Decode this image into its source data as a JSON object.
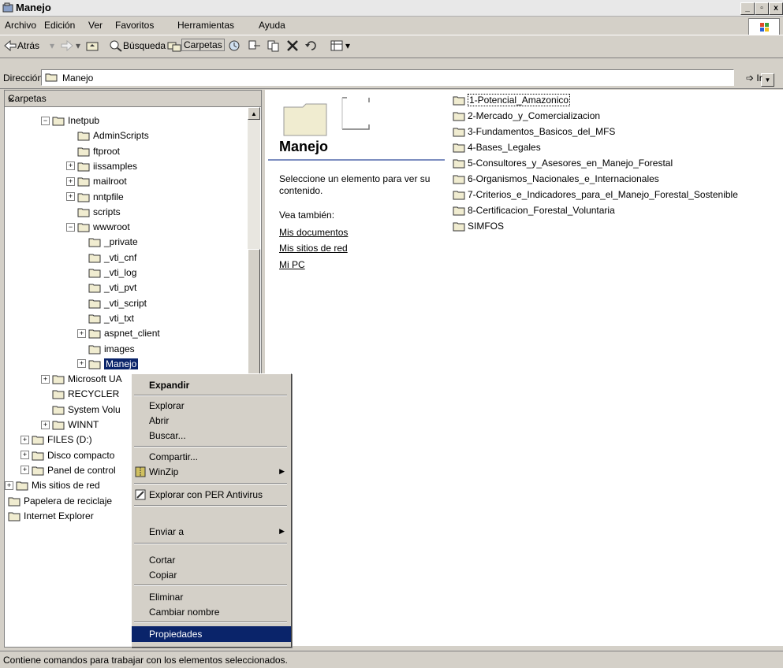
{
  "window": {
    "title": "Manejo",
    "title_icon": "window-icon",
    "minimize": "_",
    "maximize": "▫",
    "close": "x"
  },
  "menu": [
    "Archivo",
    "Edición",
    "Ver",
    "Favoritos",
    "Herramientas",
    "Ayuda"
  ],
  "toolbar": {
    "back": "Atrás",
    "search": "Búsqueda",
    "folders": "Carpetas"
  },
  "address": {
    "label": "Dirección",
    "value": "Manejo",
    "go": "Ir"
  },
  "folders_pane": {
    "title": "Carpetas",
    "close": "×",
    "tree": [
      {
        "label": "Inetpub",
        "expander": "−"
      },
      {
        "label": "AdminScripts",
        "expander": ""
      },
      {
        "label": "ftproot",
        "expander": ""
      },
      {
        "label": "iissamples",
        "expander": "+"
      },
      {
        "label": "mailroot",
        "expander": "+"
      },
      {
        "label": "nntpfile",
        "expander": "+"
      },
      {
        "label": "scripts",
        "expander": ""
      },
      {
        "label": "wwwroot",
        "expander": "−"
      },
      {
        "label": "_private",
        "expander": ""
      },
      {
        "label": "_vti_cnf",
        "expander": ""
      },
      {
        "label": "_vti_log",
        "expander": ""
      },
      {
        "label": "_vti_pvt",
        "expander": ""
      },
      {
        "label": "_vti_script",
        "expander": ""
      },
      {
        "label": "_vti_txt",
        "expander": ""
      },
      {
        "label": "aspnet_client",
        "expander": "+"
      },
      {
        "label": "images",
        "expander": ""
      },
      {
        "label": "Manejo",
        "expander": "+",
        "selected": true
      },
      {
        "label": "Microsoft UA",
        "expander": "+"
      },
      {
        "label": "RECYCLER",
        "expander": ""
      },
      {
        "label": "System Volu",
        "expander": ""
      },
      {
        "label": "WINNT",
        "expander": "+"
      },
      {
        "label": "FILES (D:)",
        "expander": "+"
      },
      {
        "label": "Disco compacto",
        "expander": "+"
      },
      {
        "label": "Panel de control",
        "expander": "+"
      },
      {
        "label": "Mis sitios de red",
        "expander": "+"
      },
      {
        "label": "Papelera de reciclaje",
        "expander": ""
      },
      {
        "label": "Internet Explorer",
        "expander": ""
      }
    ]
  },
  "content": {
    "folder_title": "Manejo",
    "description": "Seleccione un elemento para ver su contenido.",
    "see_also": "Vea también:",
    "links": [
      "Mis documentos",
      "Mis sitios de red",
      "Mi PC"
    ],
    "files": [
      "1-Potencial_Amazonico",
      "2-Mercado_y_Comercializacion",
      "3-Fundamentos_Basicos_del_MFS",
      "4-Bases_Legales",
      "5-Consultores_y_Asesores_en_Manejo_Forestal",
      "6-Organismos_Nacionales_e_Internacionales",
      "7-Criterios_e_Indicadores_para_el_Manejo_Forestal_Sostenible",
      "8-Certificacion_Forestal_Voluntaria",
      "SIMFOS"
    ]
  },
  "context_menu": {
    "expand": "Expandir",
    "explore": "Explorar",
    "open": "Abrir",
    "search": "Buscar...",
    "share": "Compartir...",
    "winzip": "WinZip",
    "antivirus": "Explorar con PER Antivirus",
    "send_to": "Enviar a",
    "cut": "Cortar",
    "copy": "Copiar",
    "delete": "Eliminar",
    "rename": "Cambiar nombre",
    "properties": "Propiedades",
    "submenu_arrow": "▶"
  },
  "statusbar": {
    "text": "Contiene comandos para trabajar con los elementos seleccionados."
  },
  "colors": {
    "selection": "#0a246a",
    "face": "#d4d0c8",
    "folder": "#e8e4c8"
  }
}
